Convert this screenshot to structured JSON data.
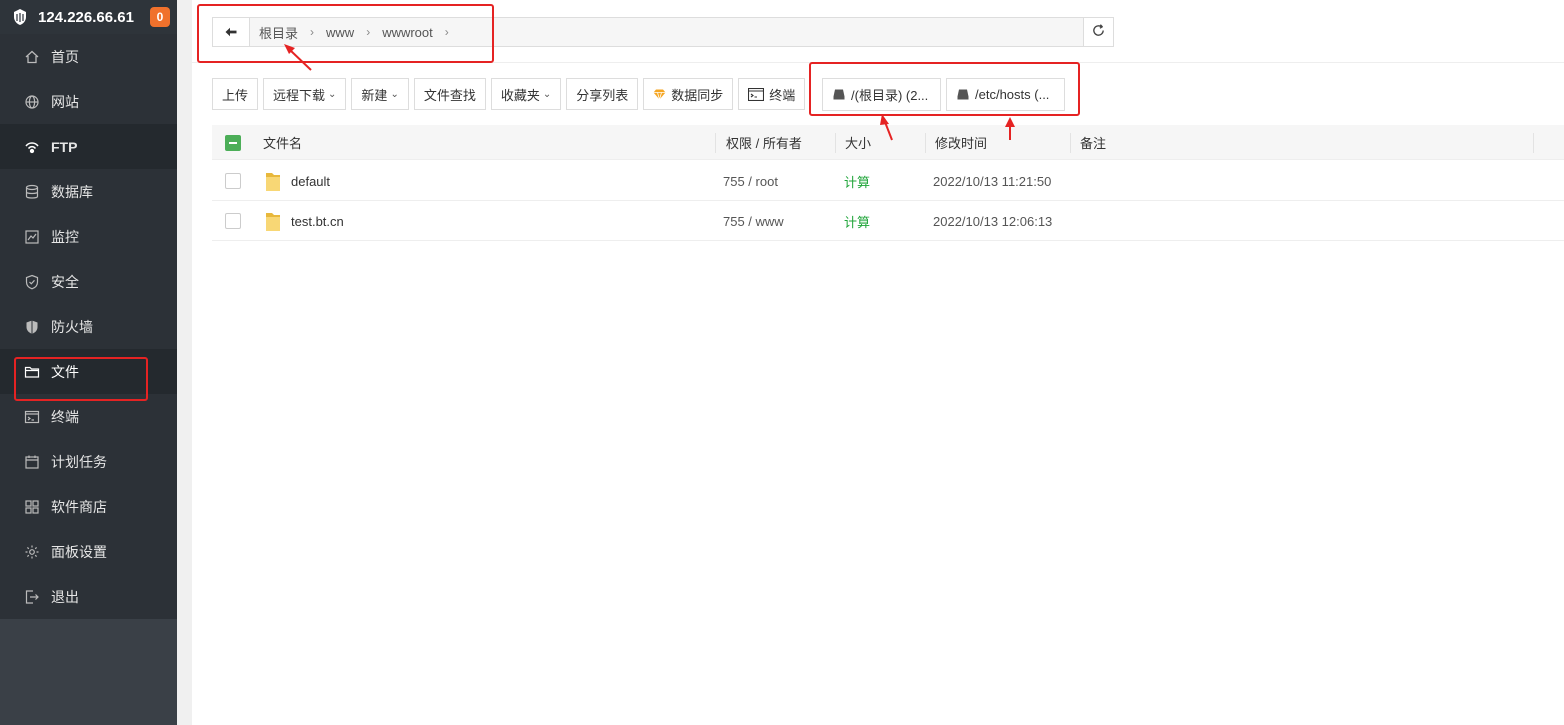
{
  "sidebar": {
    "server_ip": "124.226.66.61",
    "badge_count": "0",
    "items": [
      {
        "label": "首页",
        "icon": "home-icon"
      },
      {
        "label": "网站",
        "icon": "globe-icon"
      },
      {
        "label": "FTP",
        "icon": "ftp-icon"
      },
      {
        "label": "数据库",
        "icon": "database-icon"
      },
      {
        "label": "监控",
        "icon": "monitor-icon"
      },
      {
        "label": "安全",
        "icon": "shield-check-icon"
      },
      {
        "label": "防火墙",
        "icon": "firewall-icon"
      },
      {
        "label": "文件",
        "icon": "folder-icon"
      },
      {
        "label": "终端",
        "icon": "terminal-icon"
      },
      {
        "label": "计划任务",
        "icon": "calendar-icon"
      },
      {
        "label": "软件商店",
        "icon": "grid-icon"
      },
      {
        "label": "面板设置",
        "icon": "gear-icon"
      },
      {
        "label": "退出",
        "icon": "logout-icon"
      }
    ]
  },
  "path": {
    "crumbs": [
      "根目录",
      "www",
      "wwwroot"
    ]
  },
  "toolbar": {
    "upload": "上传",
    "remote_download": "远程下载",
    "new": "新建",
    "file_search": "文件查找",
    "favorites": "收藏夹",
    "share_list": "分享列表",
    "data_sync": "数据同步",
    "terminal": "终端"
  },
  "disks": [
    {
      "label": "/(根目录) (2..."
    },
    {
      "label": "/etc/hosts (..."
    }
  ],
  "table": {
    "headers": {
      "name": "文件名",
      "perm": "权限 / 所有者",
      "size": "大小",
      "mtime": "修改时间",
      "note": "备注"
    },
    "rows": [
      {
        "name": "default",
        "perm": "755 / root",
        "size": "计算",
        "mtime": "2022/10/13 11:21:50"
      },
      {
        "name": "test.bt.cn",
        "perm": "755 / www",
        "size": "计算",
        "mtime": "2022/10/13 12:06:13"
      }
    ]
  },
  "colors": {
    "sidebar_bg": "#2c3137",
    "accent_green": "#20a53a",
    "badge_orange": "#f0712c",
    "annotation_red": "#e52323"
  }
}
